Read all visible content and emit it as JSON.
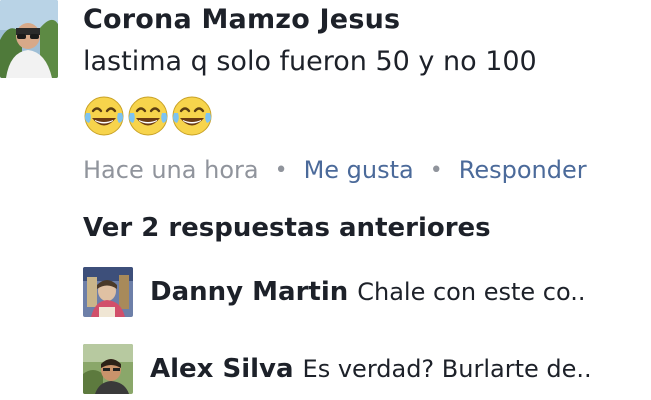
{
  "comment": {
    "author": "Corona Mamzo Jesus",
    "text": "lastima q solo fueron 50 y no 100",
    "emoji_icon": "face-with-tears-of-joy-icon",
    "emoji_count": 3,
    "time": "Hace una hora",
    "separator": "•",
    "like_label": "Me gusta",
    "reply_label": "Responder"
  },
  "replies_toggle": "Ver 2 respuestas anteriores",
  "replies": [
    {
      "author": "Danny Martin",
      "text": "Chale con este co.."
    },
    {
      "author": "Alex Silva",
      "text": "Es verdad? Burlarte de.."
    }
  ],
  "colors": {
    "author": "#1d2129",
    "meta": "#90949c",
    "link": "#4b6a9a",
    "background": "#ffffff"
  }
}
